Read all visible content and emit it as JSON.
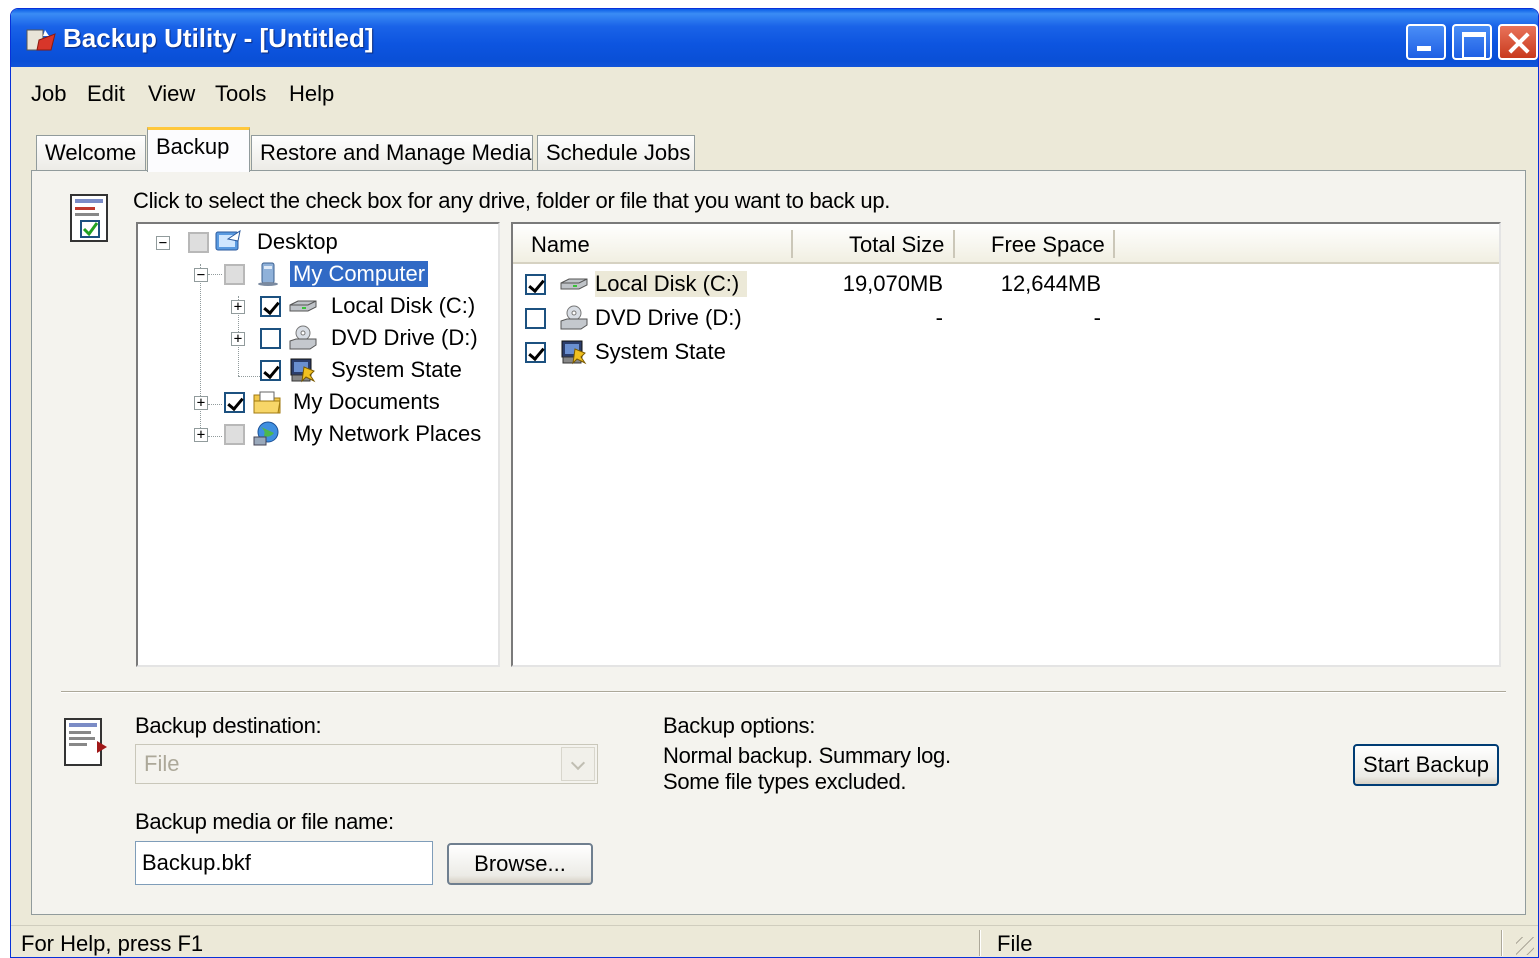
{
  "window": {
    "title": "Backup Utility - [Untitled]"
  },
  "menu": [
    "Job",
    "Edit",
    "View",
    "Tools",
    "Help"
  ],
  "tabs": [
    "Welcome",
    "Backup",
    "Restore and Manage Media",
    "Schedule Jobs"
  ],
  "active_tab": "Backup",
  "instruction": "Click to select the check box for any drive, folder or file that you want to back up.",
  "tree": [
    {
      "label": "Desktop",
      "icon": "desktop-icon",
      "state": "partial",
      "expander": "−"
    },
    {
      "label": "My Computer",
      "icon": "my-computer-icon",
      "state": "partial",
      "expander": "−",
      "selected": true
    },
    {
      "label": "Local Disk (C:)",
      "icon": "hard-disk-icon",
      "state": "checked",
      "expander": "+"
    },
    {
      "label": "DVD Drive (D:)",
      "icon": "dvd-drive-icon",
      "state": "unchecked",
      "expander": "+"
    },
    {
      "label": "System State",
      "icon": "system-state-icon",
      "state": "checked"
    },
    {
      "label": "My Documents",
      "icon": "my-documents-icon",
      "state": "checked",
      "expander": "+"
    },
    {
      "label": "My Network Places",
      "icon": "network-places-icon",
      "state": "partial",
      "expander": "+"
    }
  ],
  "list": {
    "columns": [
      "Name",
      "Total Size",
      "Free Space"
    ],
    "rows": [
      {
        "name": "Local Disk (C:)",
        "icon": "hard-disk-icon",
        "checked": true,
        "total": "19,070MB",
        "free": "12,644MB"
      },
      {
        "name": "DVD Drive (D:)",
        "icon": "dvd-drive-icon",
        "checked": false,
        "total": "-",
        "free": "-"
      },
      {
        "name": "System State",
        "icon": "system-state-icon",
        "checked": true,
        "total": "",
        "free": ""
      }
    ]
  },
  "destination": {
    "label": "Backup destination:",
    "value": "File",
    "media_label": "Backup media or file name:",
    "media_value": "Backup.bkf",
    "browse_label": "Browse..."
  },
  "options": {
    "label": "Backup options:",
    "line1": "Normal backup.  Summary log.",
    "line2": "Some file types excluded."
  },
  "start_label": "Start Backup",
  "status": {
    "help": "For Help, press F1",
    "mode": "File"
  },
  "colors": {
    "title_blue": "#0a5de6",
    "selection": "#316ac5",
    "check_green": "#21a121",
    "window_bg": "#ece9d8"
  }
}
